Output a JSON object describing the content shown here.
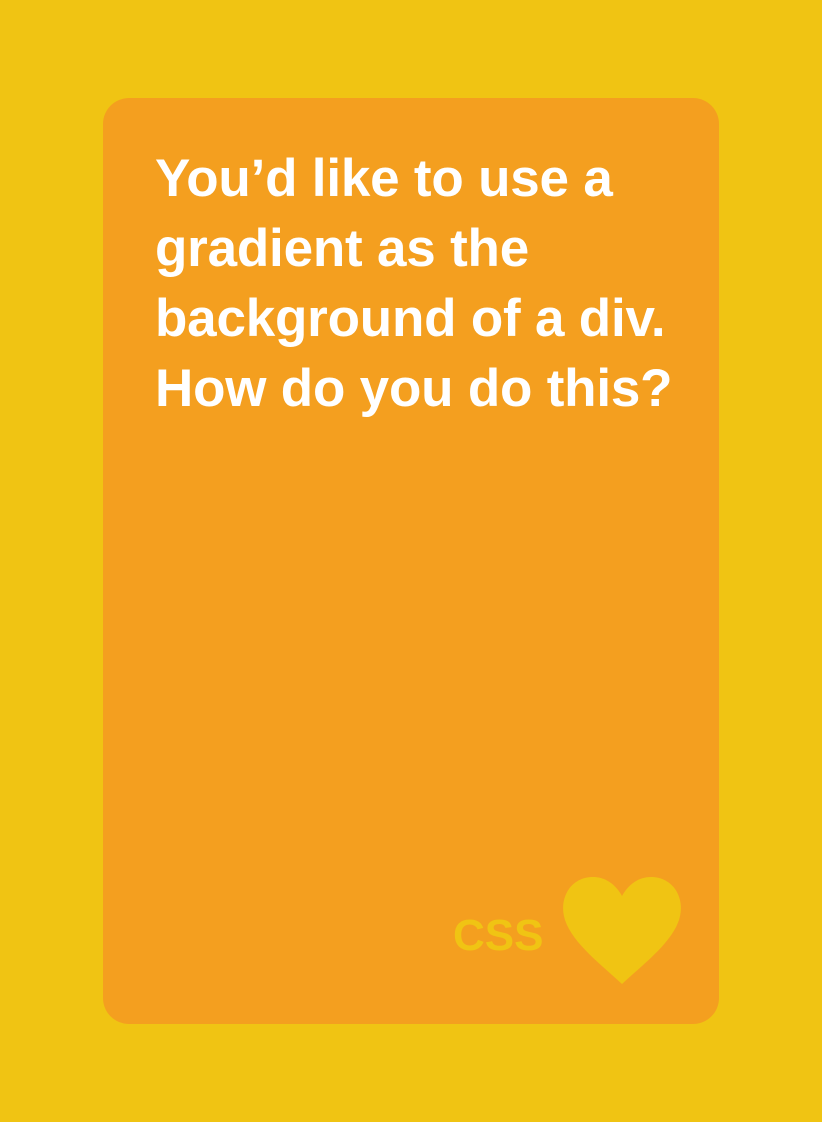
{
  "card": {
    "question_text": "You’d like to use a gradient as the background of a div. How do you do this?",
    "topic_label": "CSS",
    "icon": "heart-icon"
  },
  "colors": {
    "page_background": "#F0C413",
    "card_background": "#F49F1F",
    "question_text": "#FFFFFF",
    "brand_accent": "#F0C413"
  }
}
